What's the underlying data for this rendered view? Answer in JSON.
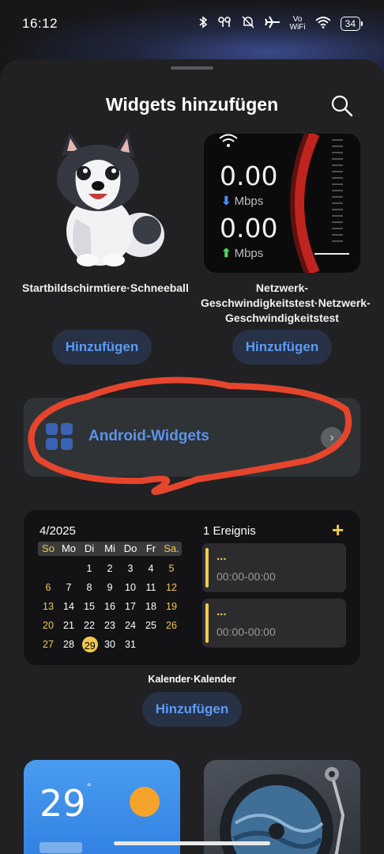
{
  "status_bar": {
    "time": "16:12",
    "vowifi_top": "Vo",
    "vowifi_bottom": "WiFi",
    "battery": "34"
  },
  "sheet": {
    "title": "Widgets hinzufügen"
  },
  "widgets": [
    {
      "caption": "Startbildschirmtiere·Schneeball",
      "add_label": "Hinzufügen"
    },
    {
      "caption": "Netzwerk-Geschwindigkeitstest·Netzwerk-Geschwindigkeitstest",
      "download_value": "0.00",
      "download_unit": "Mbps",
      "upload_value": "0.00",
      "upload_unit": "Mbps",
      "add_label": "Hinzufügen"
    }
  ],
  "android_widgets": {
    "label": "Android-Widgets"
  },
  "calendar": {
    "month": "4/2025",
    "weekdays": [
      "So",
      "Mo",
      "Di",
      "Mi",
      "Do",
      "Fr",
      "Sa."
    ],
    "weeks": [
      [
        "",
        "",
        "1",
        "2",
        "3",
        "4",
        "5"
      ],
      [
        "6",
        "7",
        "8",
        "9",
        "10",
        "11",
        "12"
      ],
      [
        "13",
        "14",
        "15",
        "16",
        "17",
        "18",
        "19"
      ],
      [
        "20",
        "21",
        "22",
        "23",
        "24",
        "25",
        "26"
      ],
      [
        "27",
        "28",
        "29",
        "30",
        "31",
        "",
        ""
      ]
    ],
    "today": "29",
    "events_title": "1 Ereignis",
    "add_event_symbol": "+",
    "events": [
      {
        "title": "...",
        "time": "00:00-00:00"
      },
      {
        "title": "...",
        "time": "00:00-00:00"
      }
    ],
    "caption": "Kalender·Kalender",
    "add_label": "Hinzufügen"
  },
  "weather": {
    "temperature": "29",
    "degree": "°"
  },
  "colors": {
    "accent_blue": "#5d9af5",
    "calendar_yellow": "#f2c94c",
    "annotation_red": "#e5452d",
    "sheet_bg": "#212123"
  }
}
